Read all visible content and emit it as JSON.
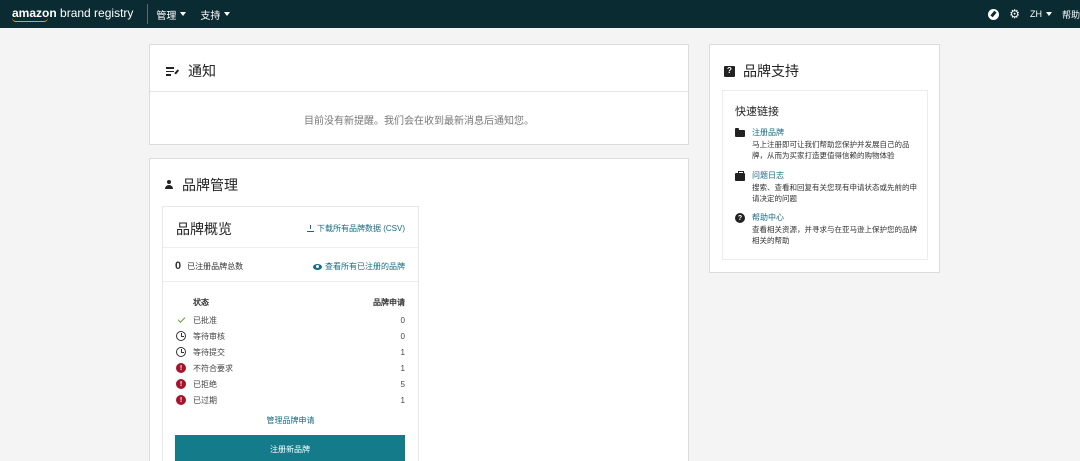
{
  "topbar": {
    "logo_brand": "amazon",
    "logo_product": "brand registry",
    "menu_manage": "管理",
    "menu_support": "支持",
    "lang": "ZH",
    "help": "帮助"
  },
  "notifications": {
    "title": "通知",
    "empty_text": "目前没有新提醒。我们会在收到最新消息后通知您。"
  },
  "brand_management": {
    "title": "品牌管理",
    "overview": {
      "title": "品牌概览",
      "download_label": "下载所有品牌数据 (CSV)",
      "total_count": "0",
      "total_label": "已注册品牌总数",
      "view_all_label": "查看所有已注册的品牌",
      "col_status": "状态",
      "col_applications": "品牌申请",
      "rows": [
        {
          "icon": "check-icon",
          "label": "已批准",
          "value": "0"
        },
        {
          "icon": "clock-icon",
          "label": "等待审核",
          "value": "0"
        },
        {
          "icon": "clock-icon",
          "label": "等待提交",
          "value": "1"
        },
        {
          "icon": "alert-icon",
          "label": "不符合要求",
          "value": "1"
        },
        {
          "icon": "alert-icon",
          "label": "已拒绝",
          "value": "5"
        },
        {
          "icon": "alert-icon",
          "label": "已过期",
          "value": "1"
        }
      ],
      "manage_link": "管理品牌申请",
      "register_button": "注册新品牌"
    }
  },
  "brand_support": {
    "title": "品牌支持",
    "quick_links_title": "快速链接",
    "links": [
      {
        "icon": "folder-icon",
        "label": "注册品牌",
        "desc": "马上注册即可让我们帮助您保护并发展自己的品牌，从而为买家打造更值得信赖的购物体验"
      },
      {
        "icon": "briefcase-icon",
        "label": "问题日志",
        "desc": "搜索、查看和回复有关您现有申请状态或先前的申请决定的问题"
      },
      {
        "icon": "question-icon",
        "label": "帮助中心",
        "desc": "查看相关资源，并寻求与在亚马逊上保护您的品牌相关的帮助"
      }
    ]
  },
  "colors": {
    "topbar": "#0b2b33",
    "link": "#146c84",
    "primary_button": "#137b8a",
    "alert": "#a5132c",
    "approved": "#6a9a3a"
  }
}
